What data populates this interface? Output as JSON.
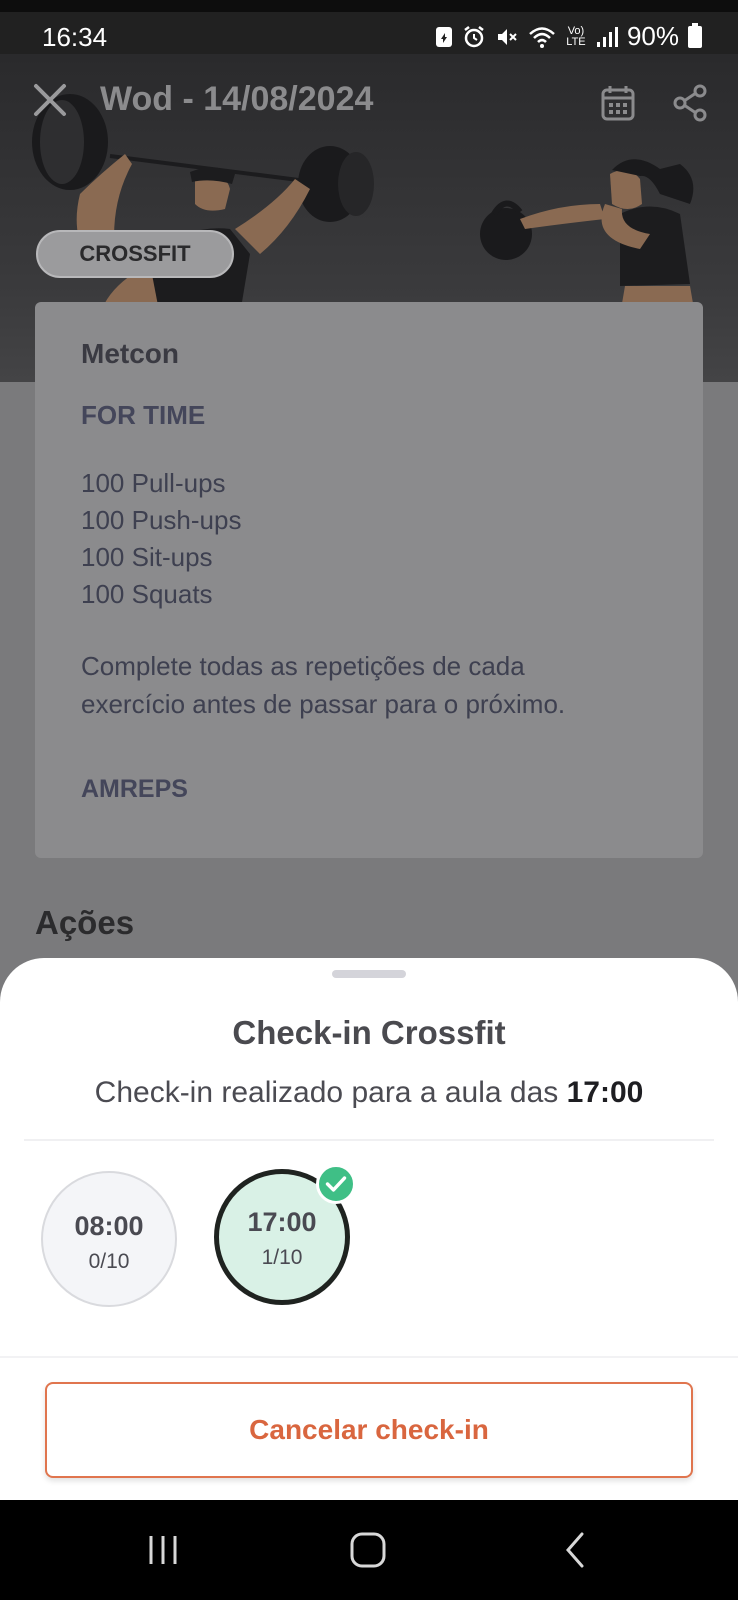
{
  "status_bar": {
    "time": "16:34",
    "battery": "90%",
    "icons": [
      "notification-icon",
      "alarm-icon",
      "mute-icon",
      "wifi-icon",
      "volte-icon",
      "signal-icon",
      "battery-icon"
    ],
    "volte_text": "Vo) LTE"
  },
  "header": {
    "title": "Wod - 14/08/2024",
    "tag": "CROSSFIT",
    "close_icon": "close-icon",
    "calendar_icon": "calendar-icon",
    "share_icon": "share-icon"
  },
  "wod": {
    "section": "Metcon",
    "format": "FOR TIME",
    "exercises": [
      "100 Pull-ups",
      "100 Push-ups",
      "100 Sit-ups",
      "100 Squats"
    ],
    "note_line1": "Complete todas as repetições de cada",
    "note_line2": "exercício antes de passar para o próximo.",
    "score_type": "AMREPS"
  },
  "actions_heading": "Ações",
  "sheet": {
    "title": "Check-in Crossfit",
    "subtitle_prefix": "Check-in realizado para a aula das",
    "subtitle_time": "17:00",
    "slots": [
      {
        "time": "08:00",
        "count": "0/10",
        "selected": false
      },
      {
        "time": "17:00",
        "count": "1/10",
        "selected": true
      }
    ],
    "cancel_label": "Cancelar check-in"
  },
  "colors": {
    "accent": "#d9663f",
    "selected_slot_bg": "#d9f1e6",
    "check_badge": "#3fbf86"
  }
}
